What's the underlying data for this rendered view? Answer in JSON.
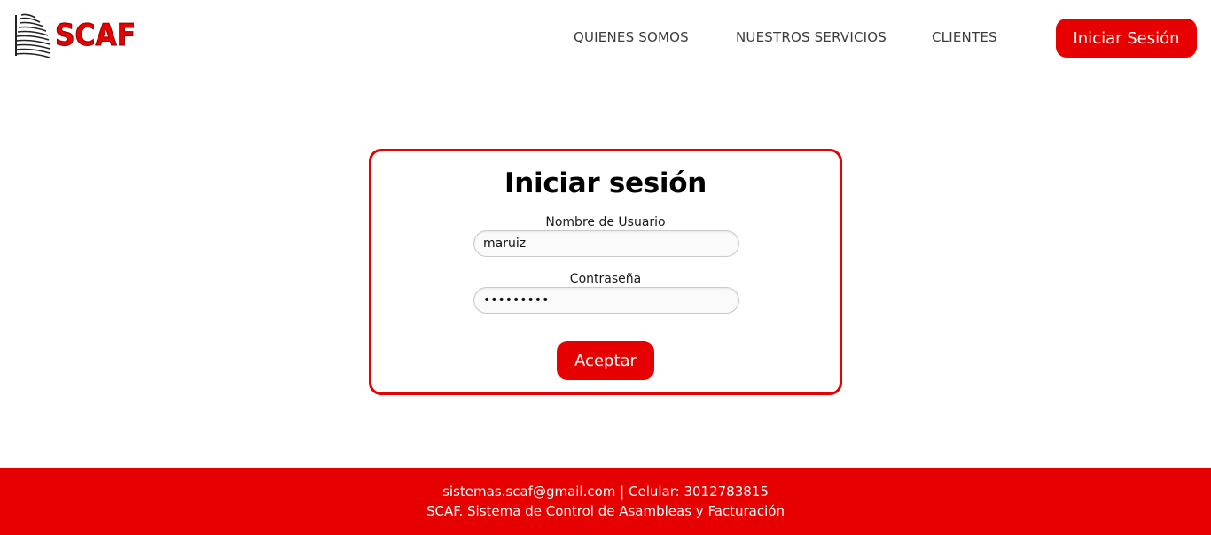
{
  "header": {
    "logo_text": "SCAF",
    "nav": {
      "quienes_somos": "QUIENES SOMOS",
      "nuestros_servicios": "NUESTROS SERVICIOS",
      "clientes": "CLIENTES"
    },
    "login_button": "Iniciar Sesión"
  },
  "login_card": {
    "title": "Iniciar sesión",
    "username_label": "Nombre de Usuario",
    "username_value": "maruiz",
    "password_label": "Contraseña",
    "password_value": "•••••••••",
    "accept_button": "Aceptar"
  },
  "footer": {
    "contact_line": "sistemas.scaf@gmail.com | Celular: 3012783815",
    "tagline": "SCAF. Sistema de Control de Asambleas y Facturación"
  },
  "colors": {
    "brand_red": "#e60000",
    "text_dark": "#1a1a1a",
    "nav_text": "#3c3c3c",
    "background": "#ffffff"
  },
  "icons": {
    "logo_mark": "building-icon"
  }
}
